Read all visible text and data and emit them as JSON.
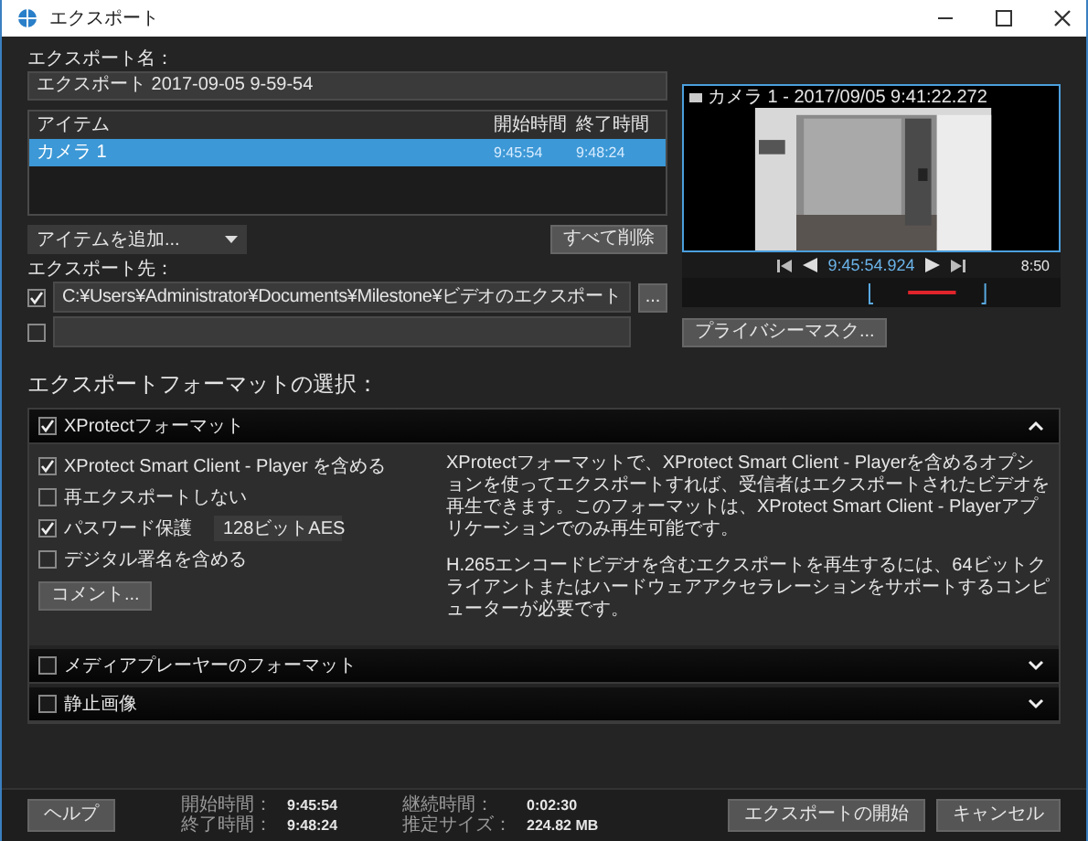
{
  "window": {
    "title": "エクスポート"
  },
  "export_name": {
    "label": "エクスポート名：",
    "value": "エクスポート 2017-09-05 9-59-54"
  },
  "items_table": {
    "columns": [
      "アイテム",
      "開始時間",
      "終了時間"
    ],
    "rows": [
      {
        "cells": [
          "カメラ 1",
          "9:45:54",
          "9:48:24"
        ],
        "selected": true
      }
    ]
  },
  "add_item": {
    "value": "アイテムを追加..."
  },
  "remove_all_button": "すべて削除",
  "destination": {
    "label": "エクスポート先：",
    "browse_button": "...",
    "rows": [
      {
        "checked": true,
        "value": "C:¥Users¥Administrator¥Documents¥Milestone¥ビデオのエクスポート"
      },
      {
        "checked": false
      }
    ]
  },
  "preview": {
    "title": "カメラ 1 - 2017/09/05 9:41:22.272",
    "time": "9:45:54.924",
    "speed": "8:50",
    "privacy_button": "プライバシーマスク..."
  },
  "format": {
    "title": "エクスポートフォーマットの選択：",
    "sections": [
      {
        "label": "XProtectフォーマット",
        "checked": true,
        "expanded": true
      },
      {
        "label": "メディアプレーヤーのフォーマット",
        "checked": false,
        "expanded": false
      },
      {
        "label": "静止画像",
        "checked": false,
        "expanded": false
      }
    ],
    "options": [
      {
        "kind": "checkbox",
        "label": "XProtect Smart Client - Player を含める",
        "checked": true
      },
      {
        "kind": "checkbox",
        "label": "再エクスポートしない",
        "checked": false
      },
      {
        "kind": "select",
        "label": "パスワード保護",
        "checked": true,
        "value": "128ビットAES"
      },
      {
        "kind": "checkbox",
        "label": "デジタル署名を含める",
        "checked": false
      }
    ],
    "comment_button": "コメント...",
    "descriptions": [
      "XProtectフォーマットで、XProtect Smart Client - Playerを含めるオプションを使ってエクスポートすれば、受信者はエクスポートされたビデオを再生できます。このフォーマットは、XProtect Smart Client - Playerアプリケーションでのみ再生可能です。",
      "H.265エンコードビデオを含むエクスポートを再生するには、64ビットクライアントまたはハードウェアアクセラレーションをサポートするコンピューターが必要です。"
    ]
  },
  "footer": {
    "help_button": "ヘルプ",
    "stats": [
      {
        "label": "開始時間：",
        "value": "9:45:54"
      },
      {
        "label": "継続時間：",
        "value": "0:02:30"
      },
      {
        "label": "終了時間：",
        "value": "9:48:24"
      },
      {
        "label": "推定サイズ：",
        "value": "224.82 MB"
      }
    ],
    "buttons": [
      "エクスポートの開始",
      "キャンセル"
    ]
  }
}
